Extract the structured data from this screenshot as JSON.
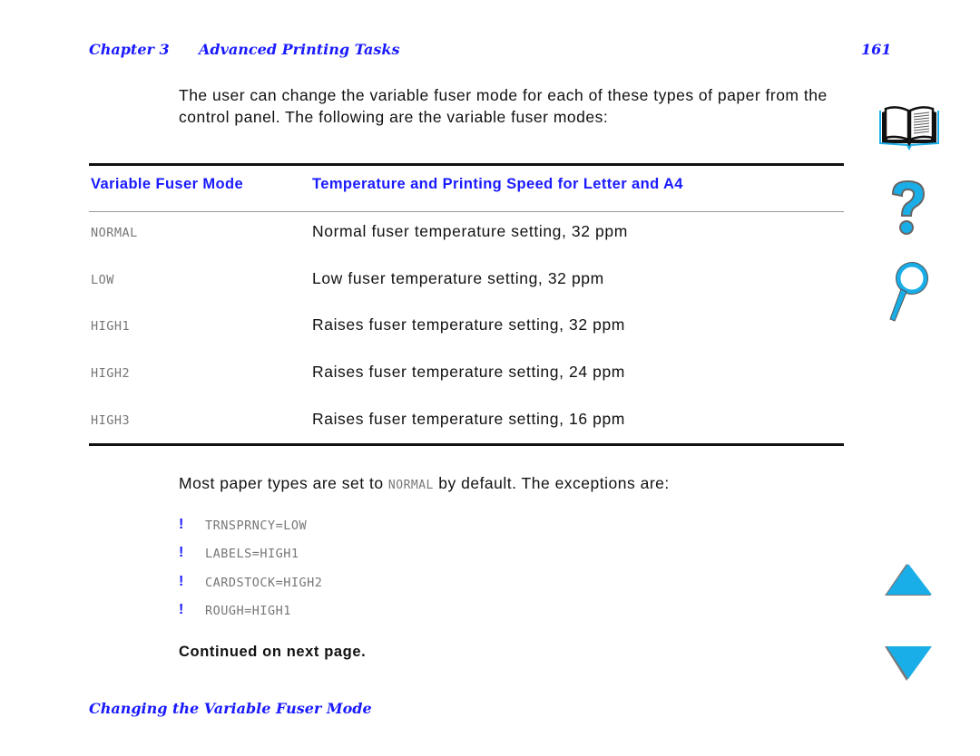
{
  "header": {
    "chapter": "Chapter 3",
    "section": "Advanced Printing Tasks",
    "page_number": "161"
  },
  "intro_text": "The user can change the variable fuser mode for each of these types of paper from the control panel. The following are the variable fuser modes:",
  "table": {
    "headers": {
      "mode": "Variable Fuser Mode",
      "description": "Temperature and Printing Speed for Letter and A4"
    },
    "rows": [
      {
        "mode": "NORMAL",
        "description": "Normal fuser temperature setting, 32 ppm"
      },
      {
        "mode": "LOW",
        "description": "Low fuser temperature setting, 32 ppm"
      },
      {
        "mode": "HIGH1",
        "description": "Raises fuser temperature setting, 32 ppm"
      },
      {
        "mode": "HIGH2",
        "description": "Raises fuser temperature setting, 24 ppm"
      },
      {
        "mode": "HIGH3",
        "description": "Raises fuser temperature setting, 16 ppm"
      }
    ]
  },
  "defaults_paragraph": {
    "before": "Most paper types are set to ",
    "code": "NORMAL",
    "after": " by default. The exceptions are:"
  },
  "exceptions": {
    "bullet_mark": "!",
    "items": [
      "TRNSPRNCY=LOW",
      "LABELS=HIGH1",
      "CARDSTOCK=HIGH2",
      "ROUGH=HIGH1"
    ]
  },
  "continued_label": "Continued on next page.",
  "footer_link": "Changing the Variable Fuser Mode",
  "nav_icons": {
    "contents": "book-icon",
    "help": "question-mark-icon",
    "search": "magnifier-icon",
    "previous_page": "up-triangle-icon",
    "next_page": "down-triangle-icon"
  },
  "colors": {
    "accent_blue": "#1a1aff",
    "icon_blue": "#1aaee8",
    "code_gray": "#777777"
  }
}
